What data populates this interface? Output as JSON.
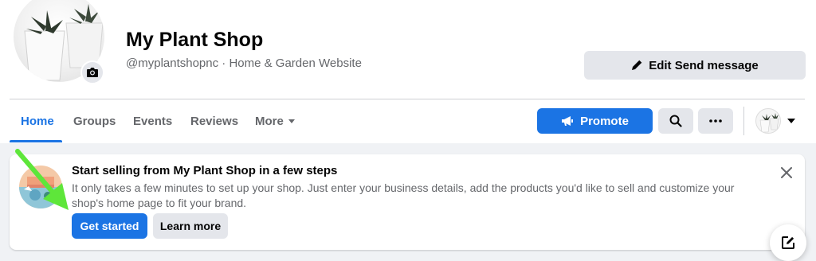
{
  "profile": {
    "name": "My Plant Shop",
    "subtitle": "@myplantshopnc · Home & Garden Website",
    "camera_icon": "camera-icon"
  },
  "actions": {
    "edit_send_message": "Edit Send message",
    "edit_icon": "pencil-icon"
  },
  "nav": {
    "tabs": [
      {
        "label": "Home",
        "active": true
      },
      {
        "label": "Groups"
      },
      {
        "label": "Events"
      },
      {
        "label": "Reviews"
      },
      {
        "label": "More"
      }
    ],
    "promote_label": "Promote",
    "search_icon": "search-icon",
    "more_icon": "ellipsis-icon",
    "profile_switch_icon": "chevron-down-icon"
  },
  "setup_card": {
    "title": "Start selling from My Plant Shop in a few steps",
    "body": "It only takes a few minutes to set up your shop. Just enter your business details, add the products you'd like to sell and customize your shop's home page to fit your brand.",
    "primary_button": "Get started",
    "secondary_button": "Learn more",
    "close_icon": "close-icon"
  },
  "colors": {
    "accent": "#1b74e4",
    "arrow": "#5ee63a",
    "background": "#f0f2f5"
  }
}
